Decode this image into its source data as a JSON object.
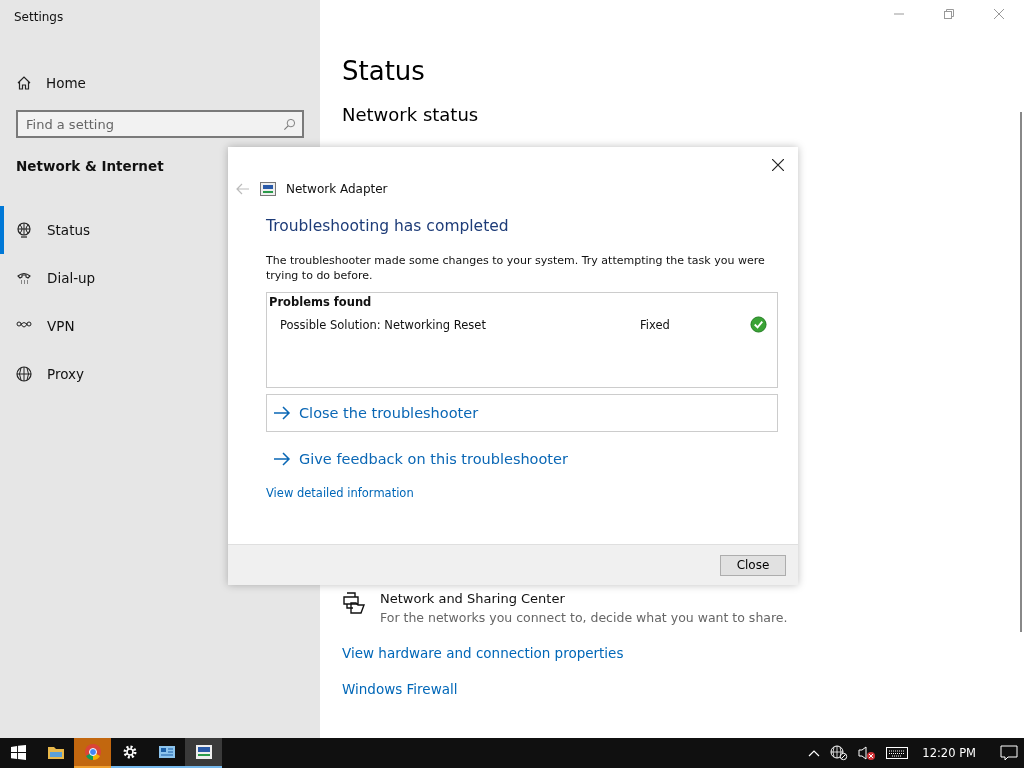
{
  "window": {
    "title": "Settings"
  },
  "sidebar": {
    "home": "Home",
    "search": {
      "placeholder": "Find a setting"
    },
    "section": "Network & Internet",
    "items": [
      {
        "label": "Status",
        "kind": "status",
        "selected": true
      },
      {
        "label": "Dial-up",
        "kind": "dialup",
        "selected": false
      },
      {
        "label": "VPN",
        "kind": "vpn",
        "selected": false
      },
      {
        "label": "Proxy",
        "kind": "proxy",
        "selected": false
      }
    ]
  },
  "content": {
    "title": "Status",
    "subtitle": "Network status",
    "sharing": {
      "title": "Network and Sharing Center",
      "description": "For the networks you connect to, decide what you want to share."
    },
    "links": [
      "View hardware and connection properties",
      "Windows Firewall"
    ]
  },
  "dialog": {
    "title": "Network Adapter",
    "heading": "Troubleshooting has completed",
    "message": "The troubleshooter made some changes to your system. Try attempting the task you were trying to do before.",
    "problems": {
      "header": "Problems found",
      "rows": [
        {
          "name": "Possible Solution: Networking Reset",
          "status": "Fixed",
          "fixed": true
        }
      ]
    },
    "actions": [
      {
        "label": "Close the troubleshooter",
        "bordered": true
      },
      {
        "label": "Give feedback on this troubleshooter",
        "bordered": false
      }
    ],
    "details_link": "View detailed information",
    "close_button": "Close"
  },
  "taskbar": {
    "apps": [
      {
        "kind": "explorer",
        "open": false,
        "flashing": false,
        "selected": false
      },
      {
        "kind": "chrome",
        "open": true,
        "flashing": true,
        "selected": false
      },
      {
        "kind": "settings",
        "open": true,
        "flashing": false,
        "selected": false
      },
      {
        "kind": "control",
        "open": true,
        "flashing": false,
        "selected": false
      },
      {
        "kind": "troubleshooter",
        "open": true,
        "flashing": false,
        "selected": true
      }
    ],
    "clock": "12:20 PM"
  }
}
